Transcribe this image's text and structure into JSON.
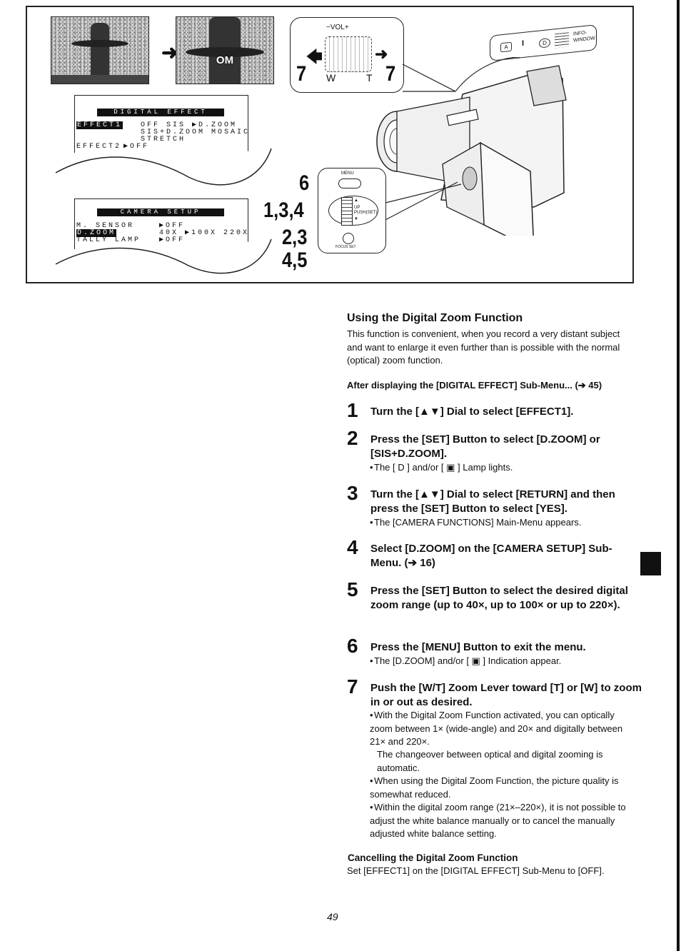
{
  "figure": {
    "photos": [
      {
        "label": "",
        "state": "wide"
      },
      {
        "label": "OM",
        "state": "zoomed"
      }
    ],
    "arrow_icon": "right-arrow",
    "digital_effect_menu": {
      "title": "DIGITAL EFFECT",
      "rows": [
        {
          "label": "EFFECT1",
          "highlighted": true,
          "options": "OFF  SIS  ▶D.ZOOM"
        },
        {
          "label": "",
          "highlighted": false,
          "options": "SIS+D.ZOOM MOSAIC"
        },
        {
          "label": "",
          "highlighted": false,
          "options": "STRETCH"
        },
        {
          "label": "EFFECT2",
          "highlighted": false,
          "options": "▶OFF"
        }
      ]
    },
    "camera_setup_menu": {
      "title": "CAMERA SETUP",
      "rows": [
        {
          "label": "M. SENSOR",
          "highlighted": false,
          "options": "▶OFF"
        },
        {
          "label": "D.ZOOM",
          "highlighted": true,
          "options": "40X ▶100X  220X"
        },
        {
          "label": "TALLY LAMP",
          "highlighted": false,
          "options": "▶OFF"
        }
      ]
    },
    "zoom_lever_callout": {
      "vol_label": "−VOL+",
      "w_label": "W",
      "t_label": "T",
      "left_step": "7",
      "right_step": "7"
    },
    "info_window": {
      "label": "INFO-WINDOW",
      "icons": [
        "A",
        "I",
        "D"
      ]
    },
    "control_callout": {
      "menu_label": "MENU",
      "dial_up": "▲",
      "dial_text": "UP PUSH(SET)",
      "dial_down": "▼",
      "set_label": "FOCUS SET",
      "step_labels": [
        "6",
        "1,3,4",
        "2,3",
        "4,5"
      ]
    }
  },
  "section": {
    "title": "Using the Digital Zoom Function",
    "intro": "This function is convenient, when you record a very distant subject and want to enlarge it even further than is possible with the normal (optical) zoom function.",
    "pre_step": "After displaying the [DIGITAL EFFECT] Sub-Menu... (➔ 45)"
  },
  "steps": [
    {
      "number": "1",
      "text": "Turn the [▲▼] Dial to select [EFFECT1].",
      "notes": []
    },
    {
      "number": "2",
      "text": "Press the [SET] Button to select [D.ZOOM] or [SIS+D.ZOOM].",
      "notes": [
        "The [ D ] and/or [ ▣ ] Lamp lights."
      ]
    },
    {
      "number": "3",
      "text": "Turn the [▲▼] Dial to select [RETURN] and then press the [SET] Button to select [YES].",
      "notes": [
        "The [CAMERA FUNCTIONS] Main-Menu appears."
      ]
    },
    {
      "number": "4",
      "text": "Select [D.ZOOM] on the [CAMERA SETUP] Sub-Menu. (➔ 16)",
      "notes": []
    },
    {
      "number": "5",
      "text": "Press the [SET] Button to select the desired digital zoom range (up to 40×, up to 100× or up to 220×).",
      "notes": []
    },
    {
      "number": "6",
      "text": "Press the [MENU] Button to exit the menu.",
      "notes": [
        "The [D.ZOOM] and/or [ ▣ ] Indication appear."
      ]
    },
    {
      "number": "7",
      "text": "Push the [W/T] Zoom Lever toward [T] or [W] to zoom in or out as desired.",
      "notes": [
        "With the Digital Zoom Function activated, you can optically zoom between 1× (wide-angle) and 20× and digitally between 21× and 220×.",
        "The changeover between optical and digital zooming is automatic.",
        "When using the Digital Zoom Function, the picture quality is somewhat reduced.",
        "Within the digital zoom range (21×–220×), it is not possible to adjust the white balance manually or to cancel the manually adjusted white balance setting."
      ]
    }
  ],
  "cancelling": {
    "title": "Cancelling the Digital Zoom Function",
    "text": "Set [EFFECT1] on the [DIGITAL EFFECT] Sub-Menu to [OFF]."
  },
  "footer": {
    "page_number": "49"
  }
}
